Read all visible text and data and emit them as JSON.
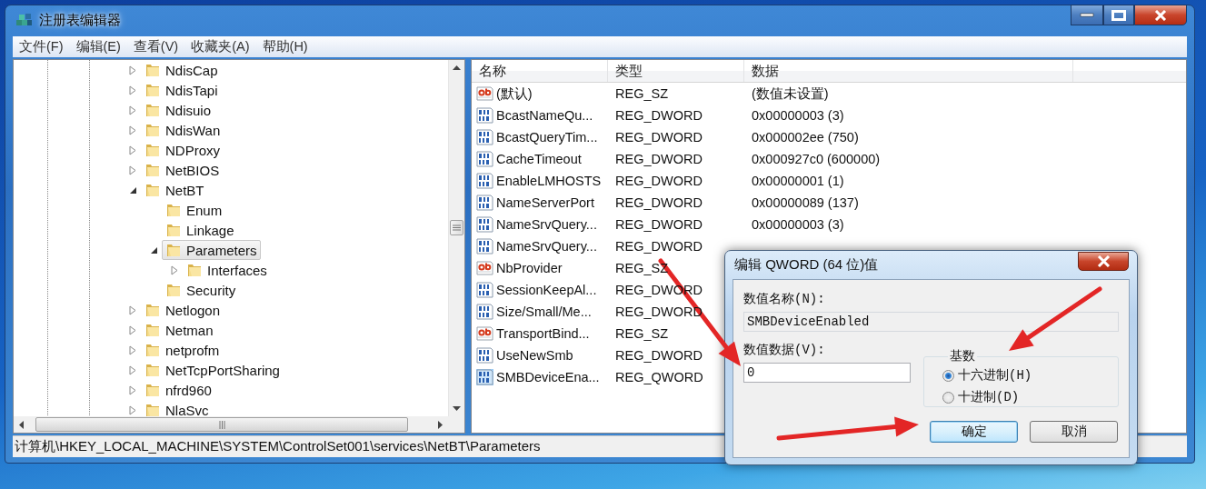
{
  "window": {
    "title": "注册表编辑器"
  },
  "menu": [
    "文件(F)",
    "编辑(E)",
    "查看(V)",
    "收藏夹(A)",
    "帮助(H)"
  ],
  "tree": [
    {
      "label": "NdisCap",
      "expanded": false,
      "selected": false
    },
    {
      "label": "NdisTapi",
      "expanded": false,
      "selected": false
    },
    {
      "label": "Ndisuio",
      "expanded": false,
      "selected": false
    },
    {
      "label": "NdisWan",
      "expanded": false,
      "selected": false
    },
    {
      "label": "NDProxy",
      "expanded": false,
      "selected": false
    },
    {
      "label": "NetBIOS",
      "expanded": false,
      "selected": false
    },
    {
      "label": "NetBT",
      "expanded": true,
      "selected": false,
      "children": [
        {
          "label": "Enum",
          "selected": false
        },
        {
          "label": "Linkage",
          "selected": false
        },
        {
          "label": "Parameters",
          "expanded": true,
          "selected": true,
          "children": [
            {
              "label": "Interfaces",
              "expanded": false,
              "selected": false
            }
          ]
        },
        {
          "label": "Security",
          "selected": false
        }
      ]
    },
    {
      "label": "Netlogon",
      "expanded": false,
      "selected": false
    },
    {
      "label": "Netman",
      "expanded": false,
      "selected": false
    },
    {
      "label": "netprofm",
      "expanded": false,
      "selected": false
    },
    {
      "label": "NetTcpPortSharing",
      "expanded": false,
      "selected": false
    },
    {
      "label": "nfrd960",
      "expanded": false,
      "selected": false
    },
    {
      "label": "NlaSvc",
      "expanded": false,
      "selected": false
    }
  ],
  "list": {
    "columns": [
      "名称",
      "类型",
      "数据"
    ],
    "rows": [
      {
        "kind": "string",
        "name": "(默认)",
        "type": "REG_SZ",
        "data": "(数值未设置)",
        "selected": false
      },
      {
        "kind": "binary",
        "name": "BcastNameQu...",
        "type": "REG_DWORD",
        "data": "0x00000003 (3)",
        "selected": false
      },
      {
        "kind": "binary",
        "name": "BcastQueryTim...",
        "type": "REG_DWORD",
        "data": "0x000002ee (750)",
        "selected": false
      },
      {
        "kind": "binary",
        "name": "CacheTimeout",
        "type": "REG_DWORD",
        "data": "0x000927c0 (600000)",
        "selected": false
      },
      {
        "kind": "binary",
        "name": "EnableLMHOSTS",
        "type": "REG_DWORD",
        "data": "0x00000001 (1)",
        "selected": false
      },
      {
        "kind": "binary",
        "name": "NameServerPort",
        "type": "REG_DWORD",
        "data": "0x00000089 (137)",
        "selected": false
      },
      {
        "kind": "binary",
        "name": "NameSrvQuery...",
        "type": "REG_DWORD",
        "data": "0x00000003 (3)",
        "selected": false
      },
      {
        "kind": "binary",
        "name": "NameSrvQuery...",
        "type": "REG_DWORD",
        "selected": false
      },
      {
        "kind": "string",
        "name": "NbProvider",
        "type": "REG_SZ",
        "selected": false
      },
      {
        "kind": "binary",
        "name": "SessionKeepAl...",
        "type": "REG_DWORD",
        "selected": false
      },
      {
        "kind": "binary",
        "name": "Size/Small/Me...",
        "type": "REG_DWORD",
        "selected": false
      },
      {
        "kind": "string",
        "name": "TransportBind...",
        "type": "REG_SZ",
        "selected": false
      },
      {
        "kind": "binary",
        "name": "UseNewSmb",
        "type": "REG_DWORD",
        "selected": false
      },
      {
        "kind": "binary",
        "name": "SMBDeviceEna...",
        "type": "REG_QWORD",
        "selected": true
      }
    ]
  },
  "status_bar": "计算机\\HKEY_LOCAL_MACHINE\\SYSTEM\\ControlSet001\\services\\NetBT\\Parameters",
  "dialog": {
    "title": "编辑 QWORD (64 位)值",
    "name_label": "数值名称(N):",
    "name_value": "SMBDeviceEnabled",
    "data_label": "数值数据(V):",
    "data_value": "0",
    "base": {
      "title": "基数",
      "options": [
        {
          "label": "十六进制(H)",
          "selected": true
        },
        {
          "label": "十进制(D)",
          "selected": false
        }
      ]
    },
    "buttons": [
      {
        "label": "确定",
        "default": true
      },
      {
        "label": "取消",
        "default": false
      }
    ]
  }
}
